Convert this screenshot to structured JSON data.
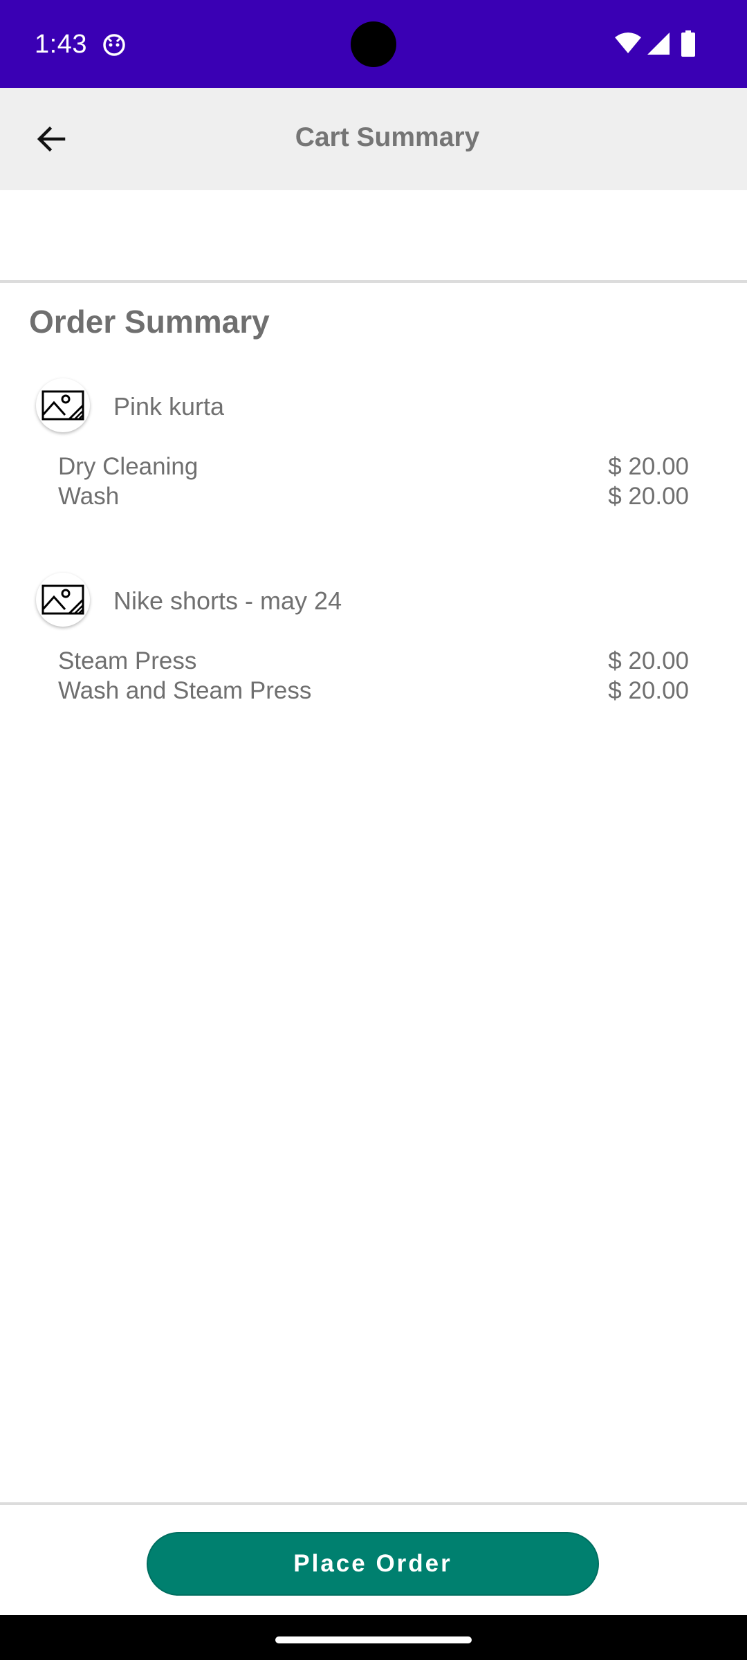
{
  "status_bar": {
    "time": "1:43",
    "color": "#3a00b4"
  },
  "app_bar": {
    "title": "Cart Summary",
    "back_icon": "arrow-back-icon"
  },
  "order_summary": {
    "heading": "Order Summary",
    "items": [
      {
        "name": "Pink kurta",
        "icon": "image-placeholder-icon",
        "services": [
          {
            "name": "Dry Cleaning",
            "price": "$ 20.00"
          },
          {
            "name": "Wash",
            "price": "$ 20.00"
          }
        ]
      },
      {
        "name": "Nike shorts - may 24",
        "icon": "image-placeholder-icon",
        "services": [
          {
            "name": "Steam Press",
            "price": "$ 20.00"
          },
          {
            "name": "Wash and Steam Press",
            "price": "$ 20.00"
          }
        ]
      }
    ]
  },
  "footer": {
    "place_order_label": "Place Order",
    "button_color": "#00806f"
  }
}
